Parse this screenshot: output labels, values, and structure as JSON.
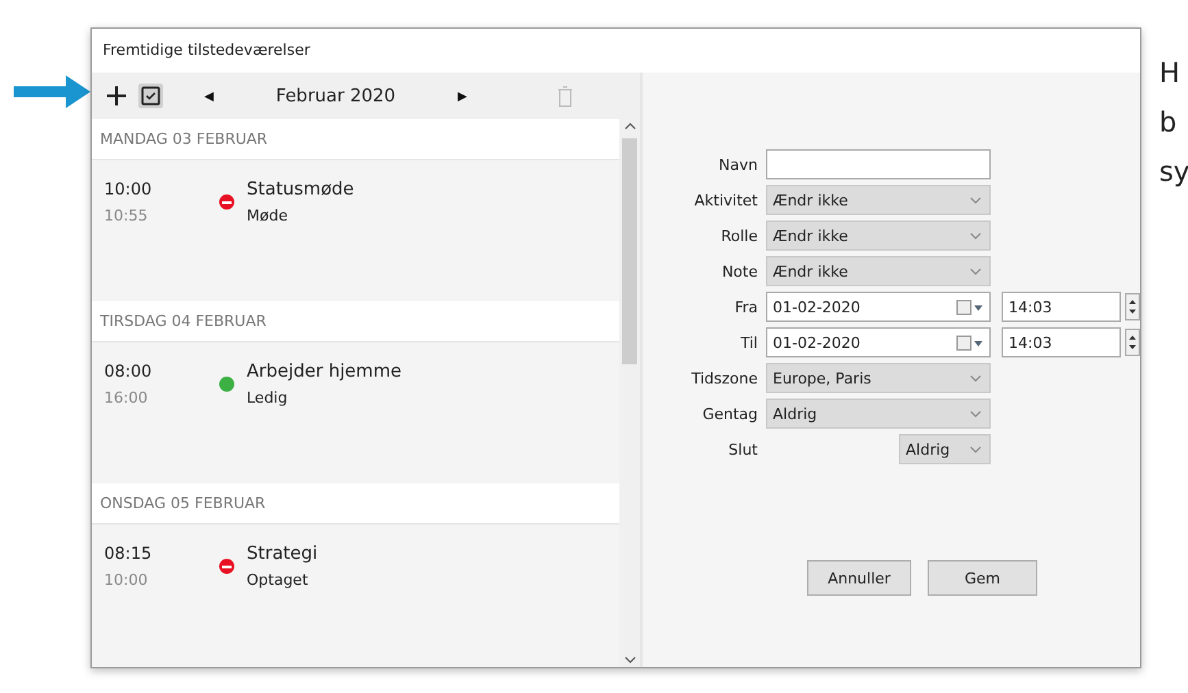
{
  "window": {
    "title": "Fremtidige tilstedeværelser"
  },
  "toolbar": {
    "month": "Februar 2020",
    "prev": "◀",
    "next": "▶"
  },
  "days": [
    {
      "heading": "MANDAG 03 FEBRUAR",
      "events": [
        {
          "start": "10:00",
          "end": "10:55",
          "title": "Statusmøde",
          "status": "Møde",
          "kind": "busy",
          "color": "#e81123"
        }
      ]
    },
    {
      "heading": "TIRSDAG 04 FEBRUAR",
      "events": [
        {
          "start": "08:00",
          "end": "16:00",
          "title": "Arbejder hjemme",
          "status": "Ledig",
          "kind": "free",
          "color": "#3cb043"
        }
      ]
    },
    {
      "heading": "ONSDAG 05 FEBRUAR",
      "events": [
        {
          "start": "08:15",
          "end": "10:00",
          "title": "Strategi",
          "status": "Optaget",
          "kind": "busy",
          "color": "#e81123"
        }
      ]
    }
  ],
  "form": {
    "fields": [
      {
        "label": "Navn",
        "kind": "text"
      },
      {
        "label": "Aktivitet",
        "kind": "select",
        "value": "Ændr ikke"
      },
      {
        "label": "Rolle",
        "kind": "select",
        "value": "Ændr ikke"
      },
      {
        "label": "Note",
        "kind": "select",
        "value": "Ændr ikke"
      },
      {
        "label": "Fra",
        "kind": "datetime",
        "value": "01-02-2020",
        "time": "14:03"
      },
      {
        "label": "Til",
        "kind": "datetime",
        "value": "01-02-2020",
        "time": "14:03"
      },
      {
        "label": "Tidszone",
        "kind": "select",
        "value": "Europe, Paris"
      },
      {
        "label": "Gentag",
        "kind": "select",
        "value": "Aldrig"
      },
      {
        "label": "Slut",
        "kind": "short-select",
        "value": "Aldrig"
      }
    ],
    "buttons": [
      "Annuller",
      "Gem"
    ]
  },
  "side_text": [
    "H",
    "b",
    "sy"
  ]
}
